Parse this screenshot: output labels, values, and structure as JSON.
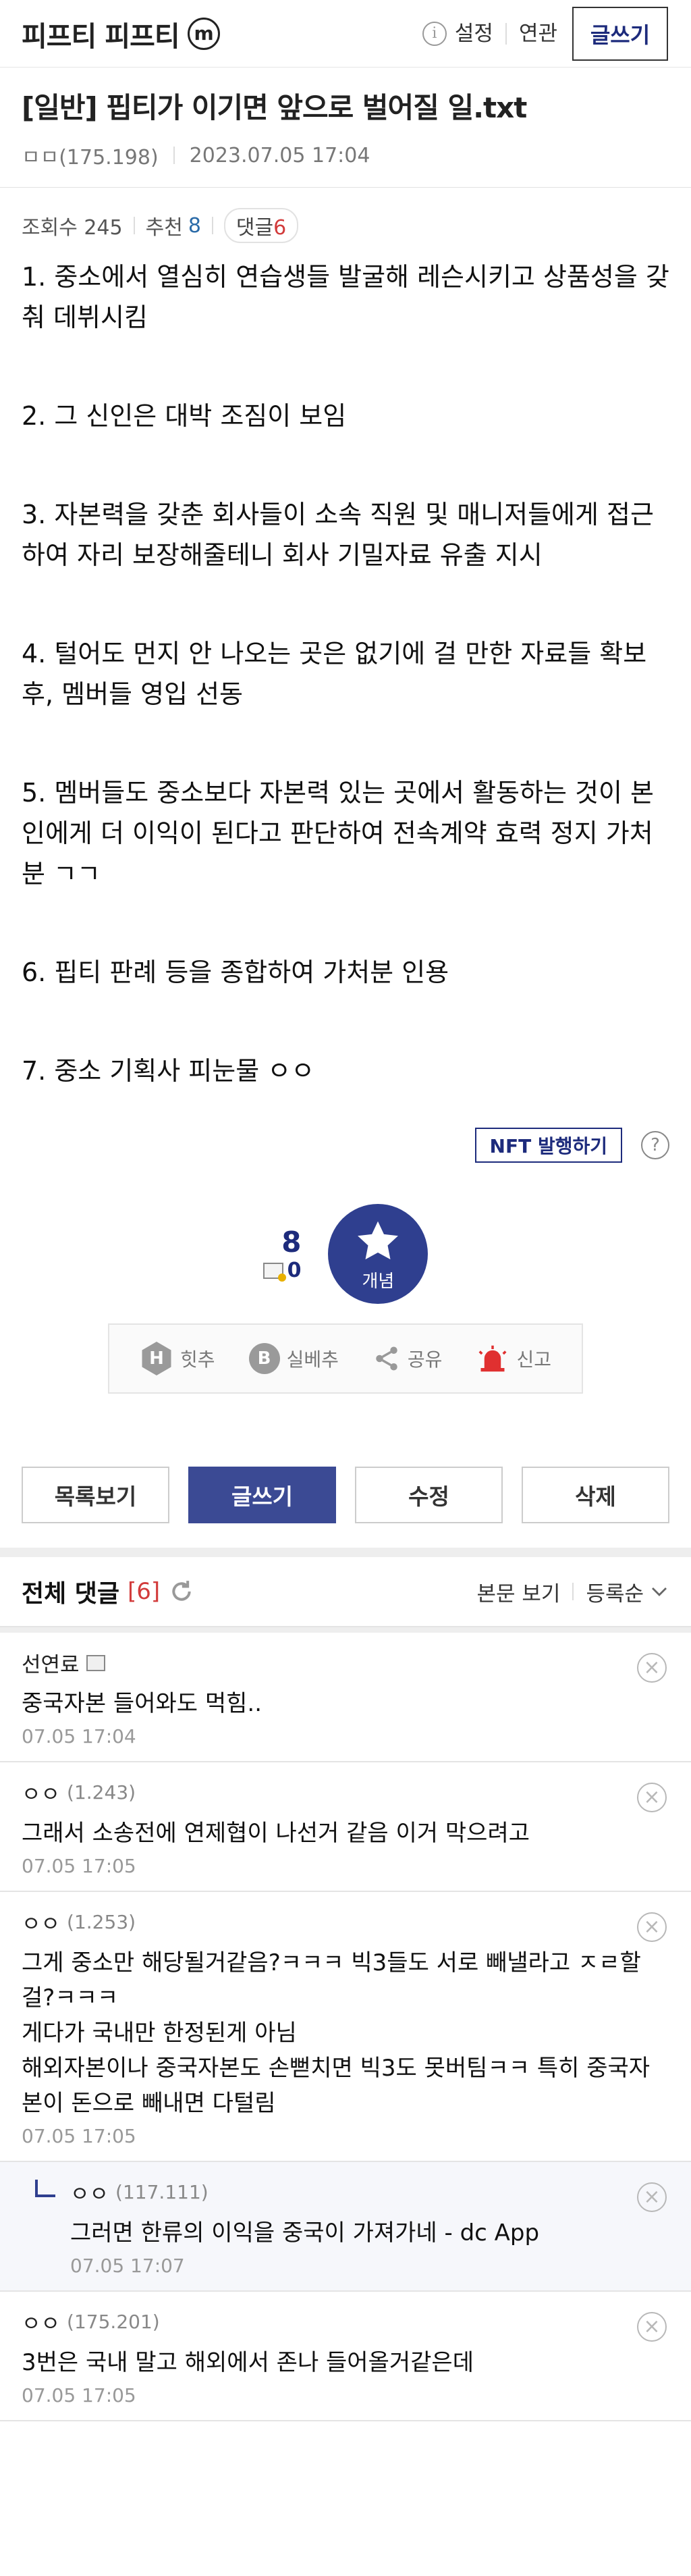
{
  "header": {
    "gallery_name": "피프티 피프티",
    "m_label": "m",
    "info_label": "i",
    "links": [
      "설정",
      "연관"
    ],
    "write_label": "글쓰기"
  },
  "post": {
    "title": "[일반] 핍티가 이기면 앞으로 벌어질 일.txt",
    "author": "ㅁㅁ(175.198)",
    "date": "2023.07.05 17:04",
    "views_label": "조회수 245",
    "recommend_label": "추천",
    "recommend_count": "8",
    "comment_label": "댓글",
    "comment_count": "6",
    "body": [
      "1. 중소에서 열심히 연습생들 발굴해 레슨시키고 상품성을 갖춰 데뷔시킴",
      "2. 그 신인은 대박 조짐이 보임",
      "3. 자본력을 갖춘 회사들이 소속 직원 및 매니저들에게 접근하여 자리 보장해줄테니 회사 기밀자료 유출 지시",
      "4. 털어도 먼지 안 나오는 곳은 없기에 걸 만한 자료들 확보 후, 멤버들 영입 선동",
      "5. 멤버들도 중소보다 자본력 있는 곳에서 활동하는 것이 본인에게 더 이익이 된다고 판단하여 전속계약 효력 정지 가처분 ㄱㄱ",
      "6. 핍티 판례 등을 종합하여 가처분 인용",
      "7. 중소 기획사 피눈물 ㅇㅇ"
    ]
  },
  "nft": {
    "label": "NFT 발행하기",
    "help": "?"
  },
  "recommend_box": {
    "up_count": "8",
    "fix_count": "0",
    "button_label": "개념"
  },
  "share_bar": [
    {
      "glyph": "H",
      "label": "힛추"
    },
    {
      "glyph": "B",
      "label": "실베추"
    },
    {
      "glyph": "",
      "label": "공유"
    },
    {
      "glyph": "",
      "label": "신고"
    }
  ],
  "bottom_buttons": [
    "목록보기",
    "글쓰기",
    "수정",
    "삭제"
  ],
  "comments_header": {
    "title": "전체 댓글",
    "count": "[6]",
    "view_body": "본문 보기",
    "sort": "등록순"
  },
  "comments": [
    {
      "author": "선연료",
      "ip": "",
      "text": "중국자본 들어와도 먹힘..",
      "date": "07.05 17:04",
      "reply": false,
      "nick_icon": true
    },
    {
      "author": "ㅇㅇ",
      "ip": "(1.243)",
      "text": "그래서 소송전에 연제협이 나선거 같음 이거 막으려고",
      "date": "07.05 17:05",
      "reply": false,
      "nick_icon": false
    },
    {
      "author": "ㅇㅇ",
      "ip": "(1.253)",
      "text": "그게 중소만 해당될거같음?ㅋㅋㅋ 빅3들도 서로 빼낼라고 ㅈㄹ할걸?ㅋㅋㅋ\n게다가 국내만 한정된게 아님\n해외자본이나 중국자본도 손뻗치면 빅3도 못버팀ㅋㅋ 특히 중국자본이 돈으로 빼내면 다털림",
      "date": "07.05 17:05",
      "reply": false,
      "nick_icon": false
    },
    {
      "author": "ㅇㅇ",
      "ip": "(117.111)",
      "text": "그러면 한류의 이익을 중국이 가져가네 - dc App",
      "date": "07.05 17:07",
      "reply": true,
      "nick_icon": false
    },
    {
      "author": "ㅇㅇ",
      "ip": "(175.201)",
      "text": "3번은 국내 말고 해외에서 존나 들어올거같은데",
      "date": "07.05 17:05",
      "reply": false,
      "nick_icon": false
    }
  ],
  "colors": {
    "accent": "#3b4a94",
    "navy": "#1d2b7c",
    "red": "#d23b3b",
    "blue": "#2b6ba8"
  }
}
